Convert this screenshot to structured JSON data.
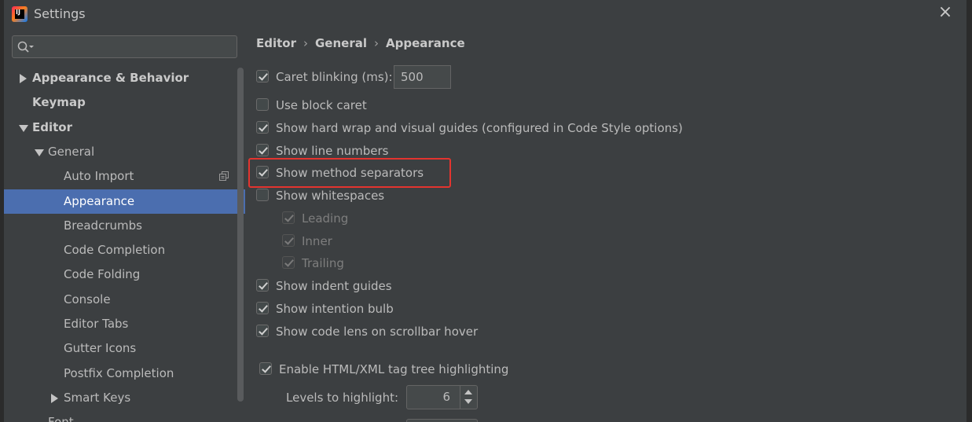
{
  "window": {
    "title": "Settings",
    "app_icon_text": "IJ",
    "close_glyph": "×"
  },
  "search": {
    "placeholder": "",
    "value": ""
  },
  "tree": {
    "items": [
      {
        "label": "Appearance & Behavior",
        "indent": 0,
        "expander": "collapsed",
        "bold": true
      },
      {
        "label": "Keymap",
        "indent": 0,
        "expander": "none",
        "bold": true
      },
      {
        "label": "Editor",
        "indent": 0,
        "expander": "expanded",
        "bold": true
      },
      {
        "label": "General",
        "indent": 1,
        "expander": "expanded",
        "bold": false
      },
      {
        "label": "Auto Import",
        "indent": 2,
        "expander": "none",
        "bold": false,
        "has_copy_icon": true
      },
      {
        "label": "Appearance",
        "indent": 2,
        "expander": "none",
        "bold": false,
        "selected": true
      },
      {
        "label": "Breadcrumbs",
        "indent": 2,
        "expander": "none",
        "bold": false
      },
      {
        "label": "Code Completion",
        "indent": 2,
        "expander": "none",
        "bold": false
      },
      {
        "label": "Code Folding",
        "indent": 2,
        "expander": "none",
        "bold": false
      },
      {
        "label": "Console",
        "indent": 2,
        "expander": "none",
        "bold": false
      },
      {
        "label": "Editor Tabs",
        "indent": 2,
        "expander": "none",
        "bold": false
      },
      {
        "label": "Gutter Icons",
        "indent": 2,
        "expander": "none",
        "bold": false
      },
      {
        "label": "Postfix Completion",
        "indent": 2,
        "expander": "none",
        "bold": false
      },
      {
        "label": "Smart Keys",
        "indent": 2,
        "expander": "collapsed",
        "bold": false
      },
      {
        "label": "Font",
        "indent": 1,
        "expander": "none",
        "bold": false
      }
    ]
  },
  "breadcrumb": {
    "items": [
      "Editor",
      "General",
      "Appearance"
    ],
    "separator": "›"
  },
  "options": [
    {
      "label": "Caret blinking (ms):",
      "checked": true,
      "disabled": false,
      "value": "500"
    },
    {
      "label": "Use block caret",
      "checked": false,
      "disabled": false
    },
    {
      "label": "Show hard wrap and visual guides (configured in Code Style options)",
      "checked": true,
      "disabled": false
    },
    {
      "label": "Show line numbers",
      "checked": true,
      "disabled": false
    },
    {
      "label": "Show method separators",
      "checked": true,
      "disabled": false,
      "highlighted": true
    },
    {
      "label": "Show whitespaces",
      "checked": false,
      "disabled": false
    },
    {
      "label": "Leading",
      "checked": true,
      "disabled": true
    },
    {
      "label": "Inner",
      "checked": true,
      "disabled": true
    },
    {
      "label": "Trailing",
      "checked": true,
      "disabled": true
    },
    {
      "label": "Show indent guides",
      "checked": true,
      "disabled": false
    },
    {
      "label": "Show intention bulb",
      "checked": true,
      "disabled": false
    },
    {
      "label": "Show code lens on scrollbar hover",
      "checked": true,
      "disabled": false
    },
    {
      "label": "Enable HTML/XML tag tree highlighting",
      "checked": true,
      "disabled": false
    }
  ],
  "levels": {
    "label": "Levels to highlight:",
    "value": "6"
  },
  "colors": {
    "selection": "#4b6eaf",
    "highlight_box": "#e3342f",
    "background": "#3c3f41"
  }
}
